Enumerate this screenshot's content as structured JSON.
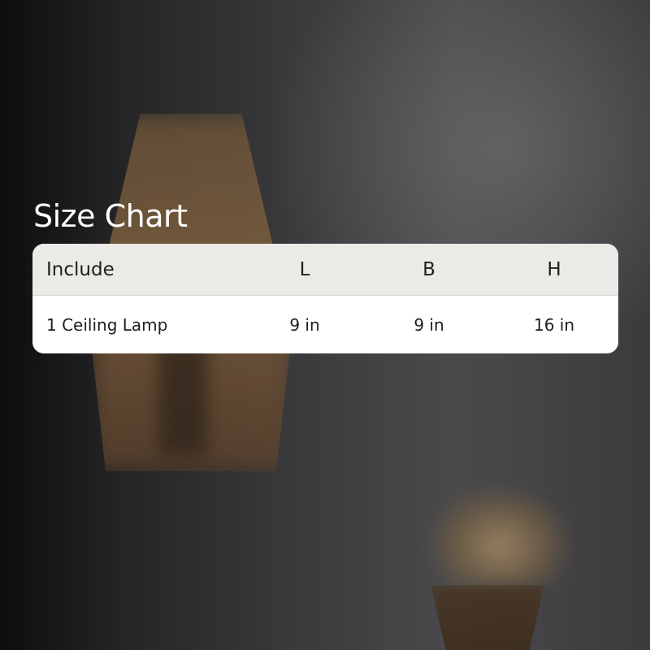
{
  "title": "Size Chart",
  "table": {
    "headers": [
      "Include",
      "L",
      "B",
      "H"
    ],
    "rows": [
      [
        "1 Ceiling Lamp",
        "9 in",
        "9 in",
        "16 in"
      ]
    ]
  }
}
